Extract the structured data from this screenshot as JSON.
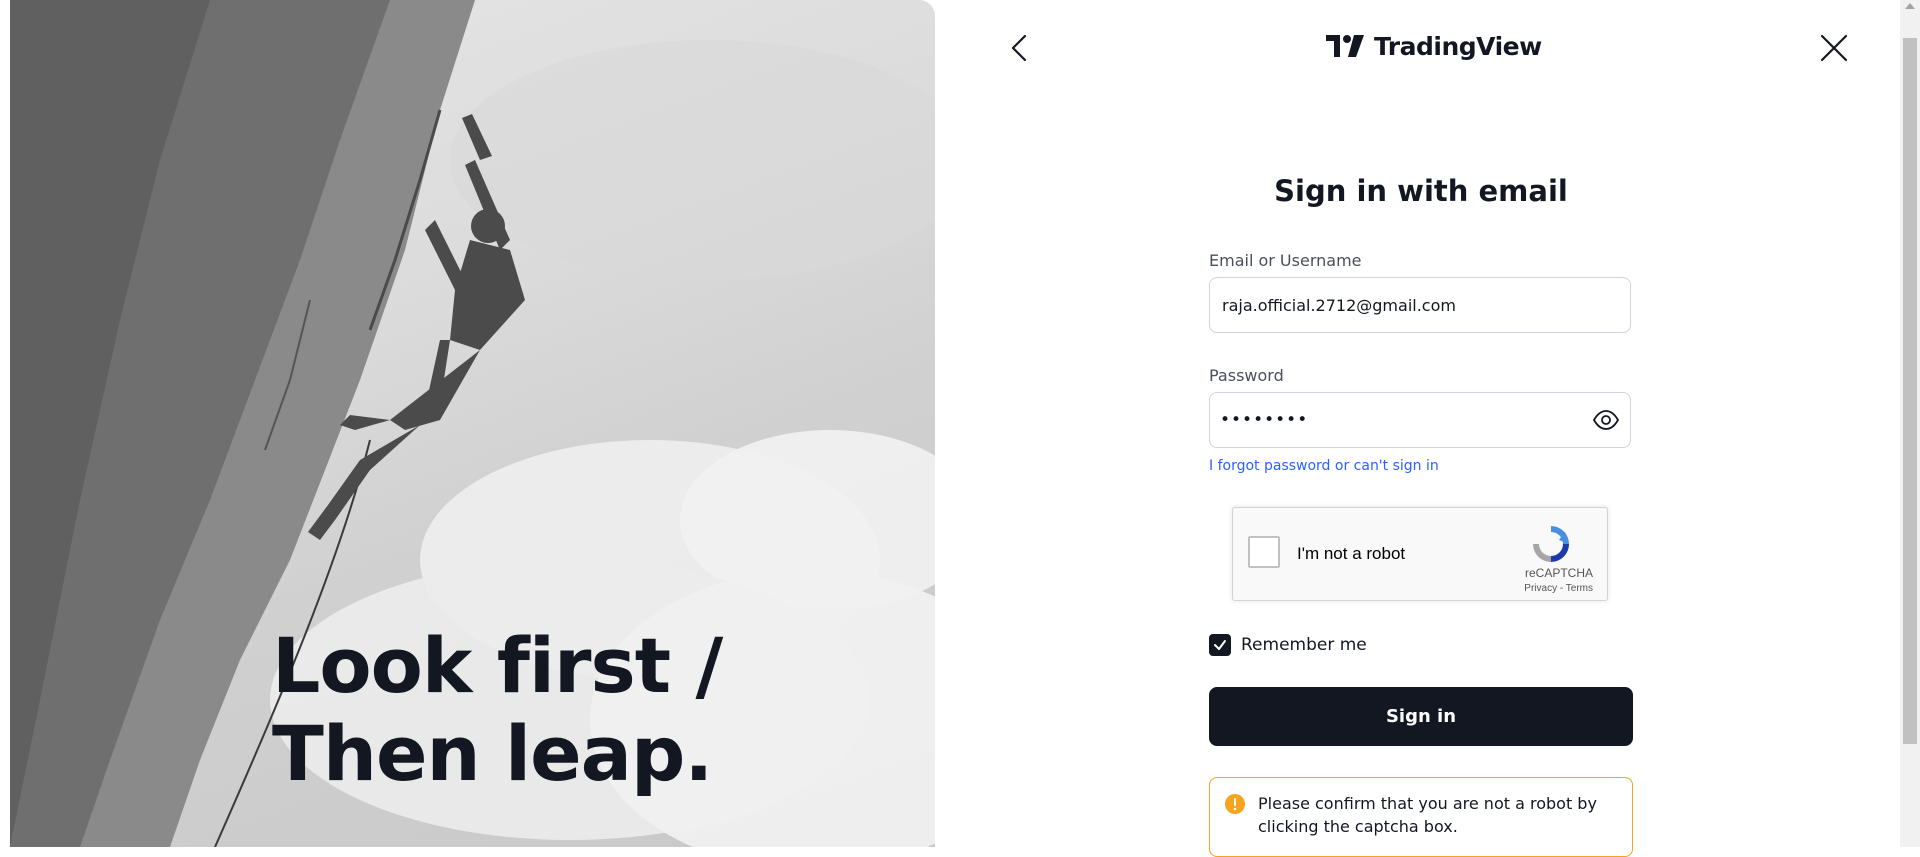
{
  "hero": {
    "headline_line1": "Look first /",
    "headline_line2": "Then leap."
  },
  "header": {
    "brand": "TradingView",
    "back_icon": "chevron-left-icon",
    "close_icon": "close-icon"
  },
  "form": {
    "title": "Sign in with email",
    "email_label": "Email or Username",
    "email_value": "raja.official.2712@gmail.com",
    "password_label": "Password",
    "password_masked": "••••••••",
    "forgot_link": "I forgot password or can't sign in",
    "remember_label": "Remember me",
    "remember_checked": true,
    "signin_label": "Sign in"
  },
  "captcha": {
    "label": "I'm not a robot",
    "brand": "reCAPTCHA",
    "terms": "Privacy - Terms",
    "checked": false
  },
  "alert": {
    "message": "Please confirm that you are not a robot by clicking the captcha box.",
    "color": "#f4a51c"
  },
  "colors": {
    "primary": "#131722",
    "link": "#2962ff",
    "warning": "#f4a51c"
  }
}
